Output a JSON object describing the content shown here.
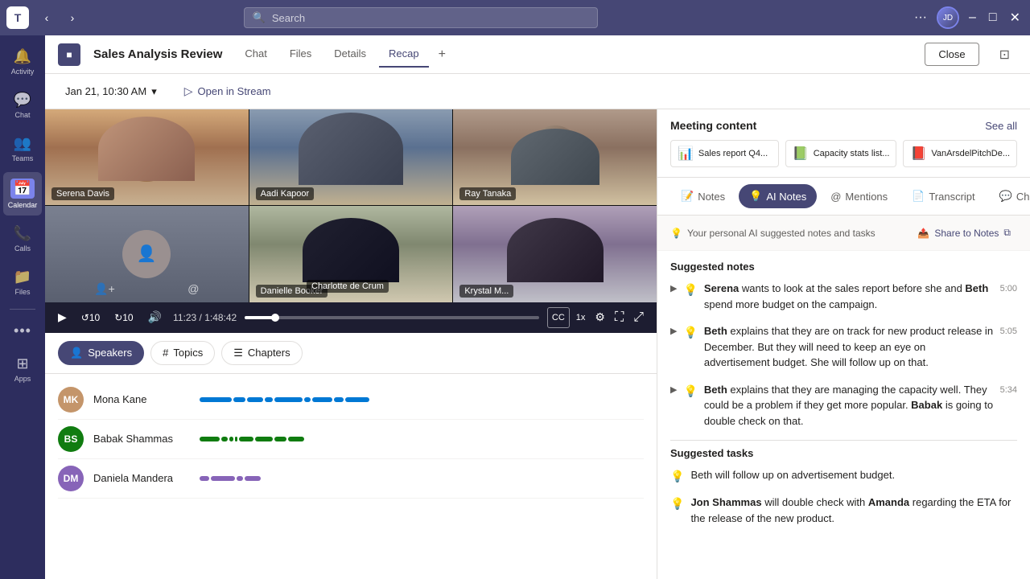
{
  "titlebar": {
    "app_icon": "T",
    "search_placeholder": "Search",
    "window_controls": [
      "minimize",
      "maximize",
      "close"
    ]
  },
  "sidebar": {
    "items": [
      {
        "id": "activity",
        "label": "Activity",
        "icon": "🔔"
      },
      {
        "id": "chat",
        "label": "Chat",
        "icon": "💬"
      },
      {
        "id": "teams",
        "label": "Teams",
        "icon": "👥"
      },
      {
        "id": "calendar",
        "label": "Calendar",
        "icon": "📅",
        "active": true
      },
      {
        "id": "calls",
        "label": "Calls",
        "icon": "📞"
      },
      {
        "id": "files",
        "label": "Files",
        "icon": "📁"
      },
      {
        "id": "more",
        "label": "...",
        "icon": "···"
      },
      {
        "id": "apps",
        "label": "Apps",
        "icon": "⊞"
      }
    ]
  },
  "meeting": {
    "icon": "■",
    "title": "Sales Analysis Review",
    "tabs": [
      "Chat",
      "Files",
      "Details",
      "Recap"
    ],
    "active_tab": "Recap",
    "close_label": "Close",
    "date_label": "Jan 21, 10:30 AM",
    "open_stream_label": "Open in Stream"
  },
  "video": {
    "participants": [
      {
        "id": "p1",
        "name": "Serena Davis",
        "color": "#c4956a"
      },
      {
        "id": "p2",
        "name": "Aadi Kapoor",
        "color": "#8a9bb0"
      },
      {
        "id": "p3",
        "name": "Ray Tanaka",
        "color": "#b09a8a"
      },
      {
        "id": "p4",
        "name": "",
        "color": "#7a8090"
      },
      {
        "id": "p5",
        "name": "Danielle Booker",
        "color": "#a0b09a"
      },
      {
        "id": "p6",
        "name": "Krystal M...",
        "color": "#b09ab0"
      },
      {
        "id": "p7",
        "name": "Charlotte de Crum",
        "color": "#90a0b0"
      }
    ],
    "current_time": "11:23",
    "total_time": "1:48:42",
    "controls": {
      "play_icon": "▶",
      "rewind_icon": "↺",
      "forward_icon": "↻",
      "volume_icon": "🔊",
      "speed": "1x",
      "fullscreen_icon": "⛶",
      "settings_icon": "⚙"
    }
  },
  "topics": {
    "buttons": [
      {
        "id": "speakers",
        "label": "Speakers",
        "icon": "👤",
        "active": true
      },
      {
        "id": "topics",
        "label": "Topics",
        "icon": "#"
      },
      {
        "id": "chapters",
        "label": "Chapters",
        "icon": "☰"
      }
    ]
  },
  "speakers": [
    {
      "name": "Mona Kane",
      "color": "#c4956a",
      "initials": "MK",
      "segments": [
        {
          "color": "#0078d4",
          "width": 40
        },
        {
          "color": "#0078d4",
          "width": 15
        },
        {
          "color": "#0078d4",
          "width": 20
        },
        {
          "color": "#0078d4",
          "width": 10
        },
        {
          "color": "#0078d4",
          "width": 35
        }
      ]
    },
    {
      "name": "Babak Shammas",
      "color": "#107c10",
      "initials": "BS",
      "segments": [
        {
          "color": "#107c10",
          "width": 25
        },
        {
          "color": "#107c10",
          "width": 8
        },
        {
          "color": "#107c10",
          "width": 5
        },
        {
          "color": "#107c10",
          "width": 18
        },
        {
          "color": "#107c10",
          "width": 22
        }
      ]
    },
    {
      "name": "Daniela Mandera",
      "color": "#8764b8",
      "initials": "DM",
      "segments": [
        {
          "color": "#8764b8",
          "width": 12
        },
        {
          "color": "#8764b8",
          "width": 30
        }
      ]
    }
  ],
  "meeting_content": {
    "section_title": "Meeting content",
    "see_all_label": "See all",
    "files": [
      {
        "id": "f1",
        "icon": "📊",
        "icon_color": "#d13438",
        "name": "Sales report Q4..."
      },
      {
        "id": "f2",
        "icon": "📗",
        "icon_color": "#107c10",
        "name": "Capacity stats list..."
      },
      {
        "id": "f3",
        "icon": "📕",
        "icon_color": "#d13438",
        "name": "VanArsdelPitchDe..."
      }
    ]
  },
  "notes_panel": {
    "tabs": [
      {
        "id": "notes",
        "label": "Notes",
        "icon": "📝"
      },
      {
        "id": "ai_notes",
        "label": "AI Notes",
        "icon": "💡",
        "active": true
      },
      {
        "id": "mentions",
        "label": "Mentions",
        "icon": "@"
      },
      {
        "id": "transcript",
        "label": "Transcript",
        "icon": "📄"
      },
      {
        "id": "chat",
        "label": "Chat",
        "icon": "💬"
      }
    ],
    "subtitle": "Your personal AI suggested notes and tasks",
    "share_notes_label": "Share to Notes",
    "suggested_notes_title": "Suggested notes",
    "notes": [
      {
        "id": "n1",
        "text_parts": [
          {
            "text": "Serena",
            "bold": true
          },
          {
            "text": " wants to look at the sales report before she and "
          },
          {
            "text": "Beth",
            "bold": true
          },
          {
            "text": " spend more budget on the campaign."
          }
        ],
        "time": "5:00"
      },
      {
        "id": "n2",
        "text_parts": [
          {
            "text": "Beth",
            "bold": true
          },
          {
            "text": " explains that they are on track for new product release in December. But they will need to keep an eye on advertisement budget. She will follow up on that."
          }
        ],
        "time": "5:05"
      },
      {
        "id": "n3",
        "text_parts": [
          {
            "text": "Beth",
            "bold": true
          },
          {
            "text": " explains that they are managing the capacity well. They could be a problem if they get more popular. "
          },
          {
            "text": "Babak",
            "bold": true
          },
          {
            "text": " is going to double check on that."
          }
        ],
        "time": "5:34"
      }
    ],
    "suggested_tasks_title": "Suggested tasks",
    "tasks": [
      {
        "id": "t1",
        "text_parts": [
          {
            "text": "Beth will follow up on advertisement budget."
          }
        ]
      },
      {
        "id": "t2",
        "text_parts": [
          {
            "text": "Jon Shammas",
            "bold": true
          },
          {
            "text": " will double check with "
          },
          {
            "text": "Amanda",
            "bold": true
          },
          {
            "text": " regarding the ETA for the release of the new product."
          }
        ]
      }
    ]
  }
}
